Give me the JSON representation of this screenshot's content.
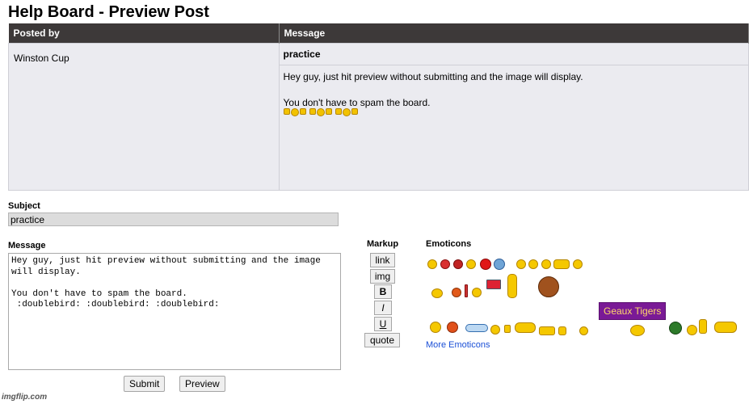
{
  "page": {
    "title": "Help Board - Preview Post"
  },
  "preview": {
    "header_posted_by": "Posted by",
    "header_message": "Message",
    "author": "Winston Cup",
    "subject": "practice",
    "body_line1": "Hey guy, just hit preview without submitting and the image will display.",
    "body_line2": "You don't have to spam the board.",
    "emoticons": [
      "doublebird",
      "doublebird",
      "doublebird"
    ]
  },
  "form": {
    "subject_label": "Subject",
    "subject_value": "practice",
    "message_label": "Message",
    "message_value": "Hey guy, just hit preview without submitting and the image will display.\n\nYou don't have to spam the board.\n :doublebird: :doublebird: :doublebird:",
    "submit_label": "Submit",
    "preview_label": "Preview"
  },
  "markup": {
    "label": "Markup",
    "buttons": [
      "link",
      "img",
      "B",
      "I",
      "U",
      "quote"
    ]
  },
  "emoticons_panel": {
    "label": "Emoticons",
    "more_link": "More Emoticons",
    "tooltip": "Geaux Tigers"
  },
  "watermark": "imgflip.com",
  "colors": {
    "header_bg": "#3d3939",
    "cell_bg": "#ebebf0",
    "tooltip_bg": "#7a1a96",
    "link": "#1a4fd6"
  }
}
